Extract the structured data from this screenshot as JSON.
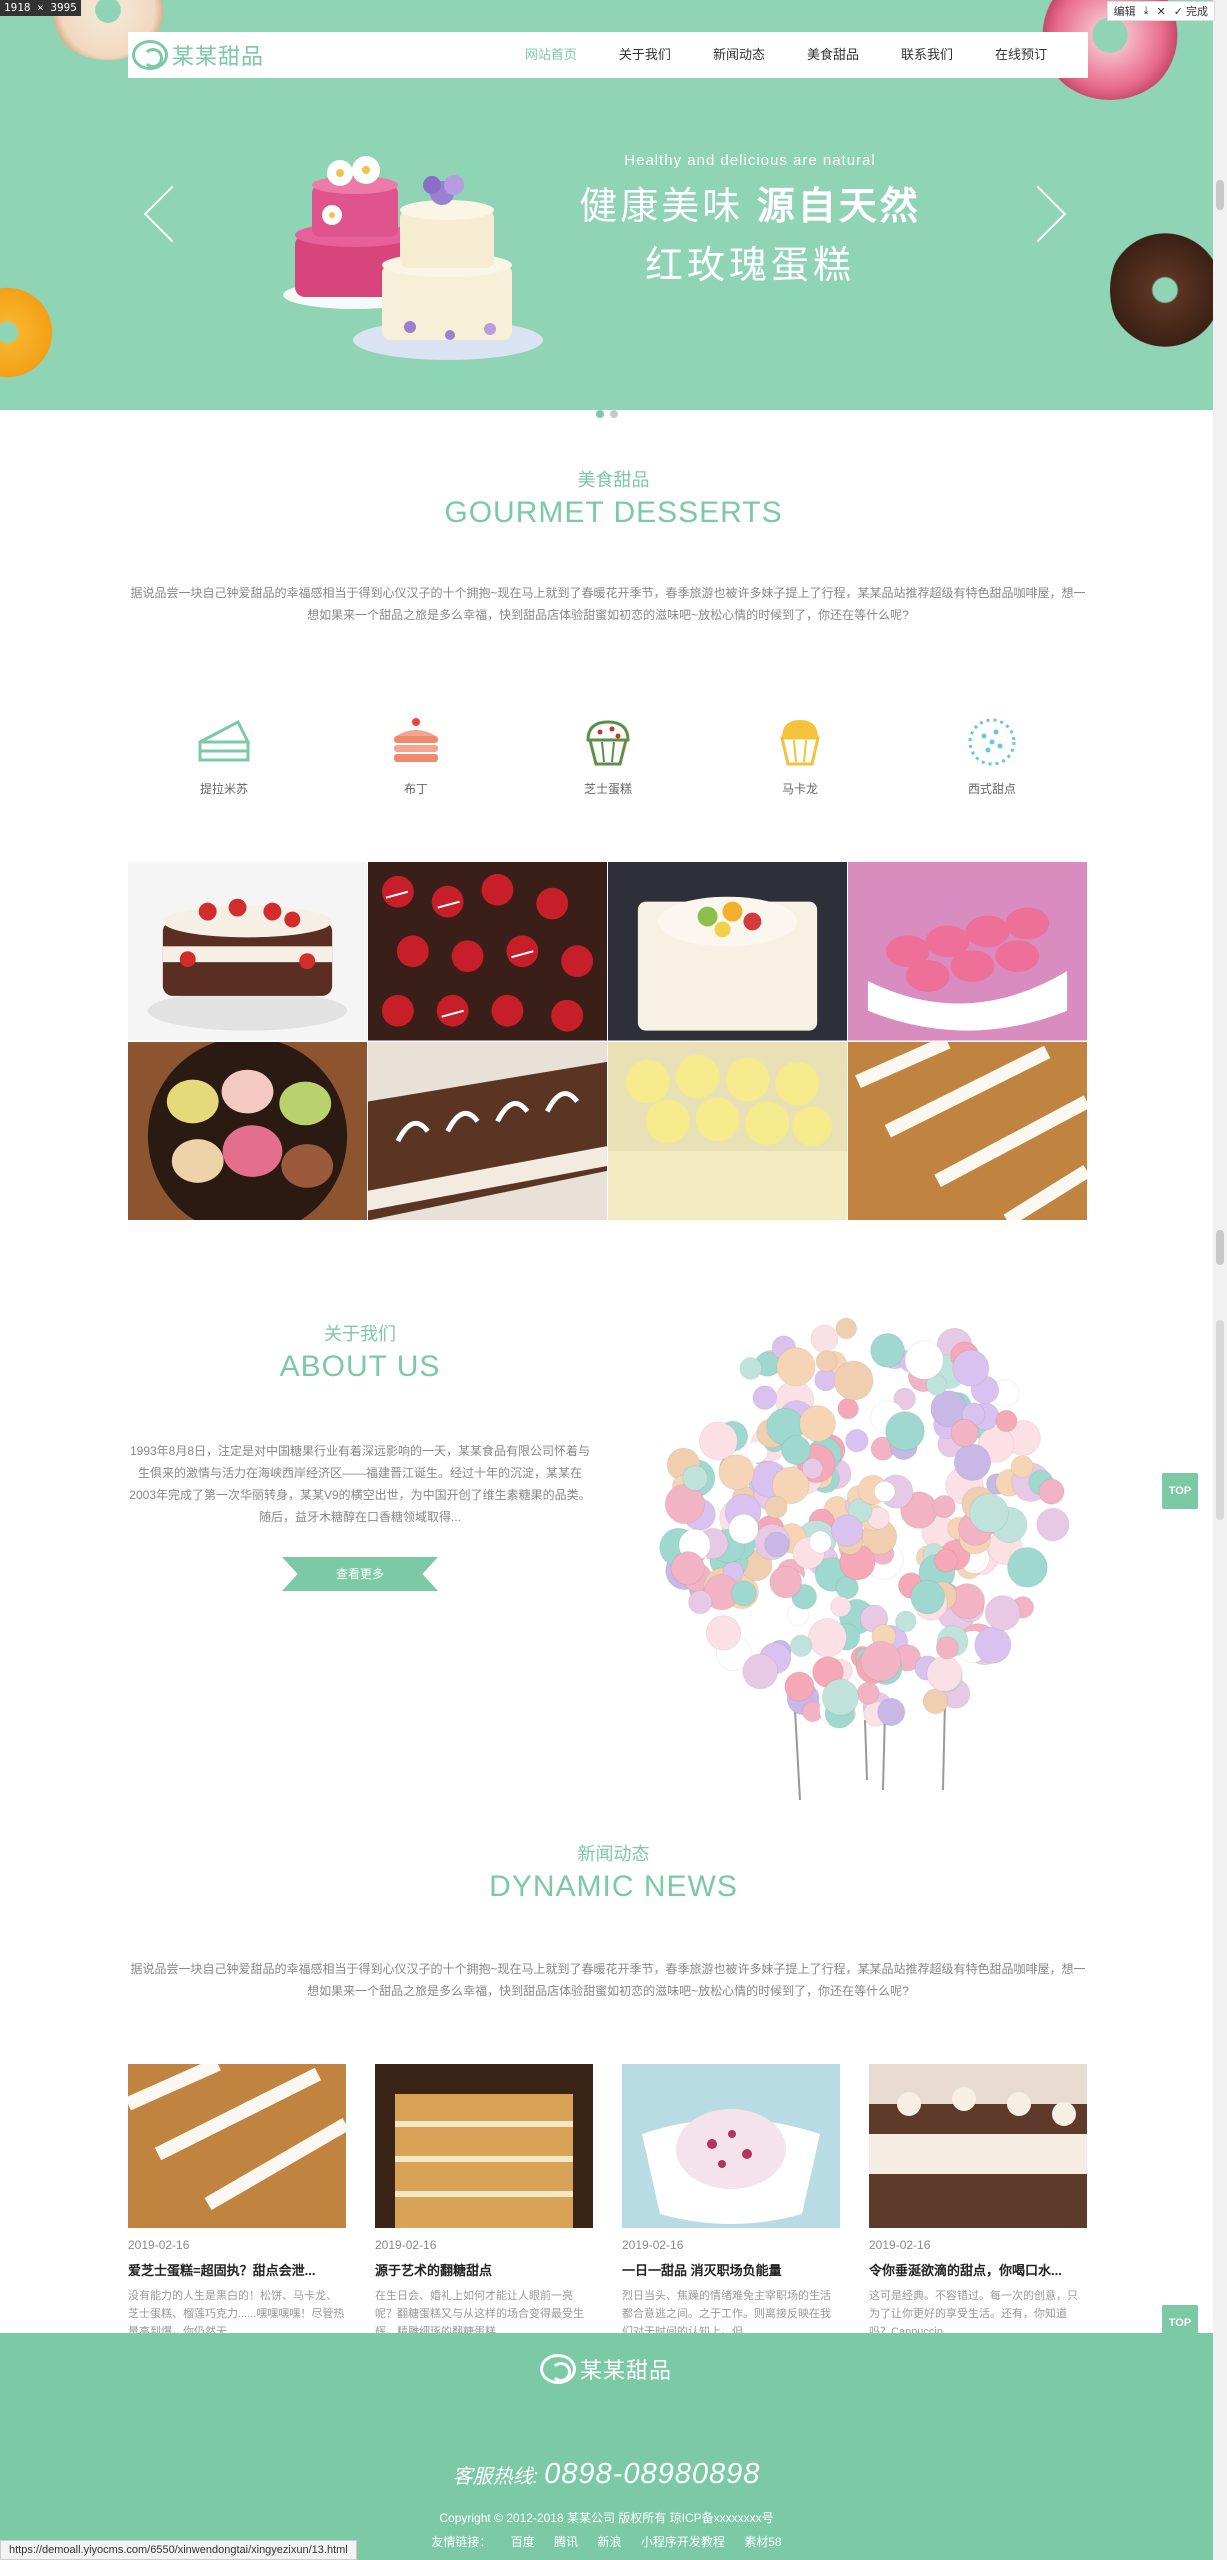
{
  "browser": {
    "dimension_label": "1918 × 3995",
    "toolbar_edit": "编辑",
    "toolbar_done": "完成",
    "status_url": "https://demoall.yiyocms.com/6550/xinwendongtai/xingyezixun/13.html"
  },
  "nav": {
    "logo_text": "某某甜品",
    "items": [
      {
        "label": "网站首页",
        "active": true
      },
      {
        "label": "关于我们"
      },
      {
        "label": "新闻动态"
      },
      {
        "label": "美食甜品"
      },
      {
        "label": "联系我们"
      },
      {
        "label": "在线预订"
      }
    ]
  },
  "hero": {
    "tagline_en": "Healthy and delicious are natural",
    "headline_left": "健康美味",
    "headline_right": "源自天然",
    "subheadline": "红玫瑰蛋糕",
    "slides": 2,
    "active_slide": 1
  },
  "desserts": {
    "title_cn": "美食甜品",
    "title_en": "GOURMET DESSERTS",
    "description": "据说品尝一块自己钟爱甜品的幸福感相当于得到心仪汉子的十个拥抱~现在马上就到了春暖花开季节，春季旅游也被许多妹子提上了行程，某某品站推荐超级有特色甜品咖啡屋，想一想如果来一个甜品之旅是多么幸福，快到甜品店体验甜蜜如初恋的滋味吧~放松心情的时候到了，你还在等什么呢?",
    "categories": [
      {
        "label": "提拉米苏",
        "icon": "cake-slice-icon"
      },
      {
        "label": "布丁",
        "icon": "pudding-icon"
      },
      {
        "label": "芝士蛋糕",
        "icon": "cupcake-icon"
      },
      {
        "label": "马卡龙",
        "icon": "macaron-cupcake-icon"
      },
      {
        "label": "西式甜点",
        "icon": "sprinkle-ball-icon"
      }
    ]
  },
  "about": {
    "title_cn": "关于我们",
    "title_en": "ABOUT US",
    "body": "1993年8月8日，注定是对中国糖果行业有着深远影响的一天，某某食品有限公司怀着与生俱来的激情与活力在海峡西岸经济区——福建晋江诞生。经过十年的沉淀，某某在2003年完成了第一次华丽转身，某某V9的横空出世，为中国开创了维生素糖果的品类。随后，益牙木糖醇在口香糖领域取得...",
    "more_label": "查看更多"
  },
  "news": {
    "title_cn": "新闻动态",
    "title_en": "DYNAMIC NEWS",
    "description": "据说品尝一块自己钟爱甜品的幸福感相当于得到心仪汉子的十个拥抱~现在马上就到了春暖花开季节，春季旅游也被许多妹子提上了行程，某某品站推荐超级有特色甜品咖啡屋，想一想如果来一个甜品之旅是多么幸福，快到甜品店体验甜蜜如初恋的滋味吧~放松心情的时候到了，你还在等什么呢?",
    "items": [
      {
        "date": "2019-02-16",
        "title": "爱芝士蛋糕=超固执？甜点会泄...",
        "excerpt": "没有能力的人生是黑白的！松饼、马卡龙、芝士蛋糕、榴莲巧克力......嘿嘿嘿嘿！尽管热量高到爆，你仍然无..."
      },
      {
        "date": "2019-02-16",
        "title": "源于艺术的翻糖甜点",
        "excerpt": "在生日会、婚礼上如何才能让人眼前一亮呢？翻糖蛋糕又与从这样的场合变得最受生辉。精雕细琢的翻糖蛋糕..."
      },
      {
        "date": "2019-02-16",
        "title": "一日一甜品 消灭职场负能量",
        "excerpt": "烈日当头、焦躁的情绪难免主宰职场的生活都合意逃之间。之于工作。则离接反映在我们对于时间的认知上。但..."
      },
      {
        "date": "2019-02-16",
        "title": "令你垂涎欲滴的甜点，你喝口水...",
        "excerpt": "这可是经典。不容错过。每一次的创意，只为了让你更好的享受生活。还有，你知道吗？Cappuccin..."
      }
    ]
  },
  "top_label": "TOP",
  "footer": {
    "logo_text": "某某甜品",
    "hotline_label": "客服热线:",
    "hotline_number": "0898-08980898",
    "copyright": "Copyright © 2012-2018 某某公司 版权所有 琼ICP备xxxxxxxx号",
    "links_label": "友情链接：",
    "links": [
      "百度",
      "腾讯",
      "新浪",
      "小程序开发教程",
      "素材58"
    ]
  },
  "colors": {
    "accent": "#7cc9a6",
    "hero_bg": "#8fd4b4"
  }
}
